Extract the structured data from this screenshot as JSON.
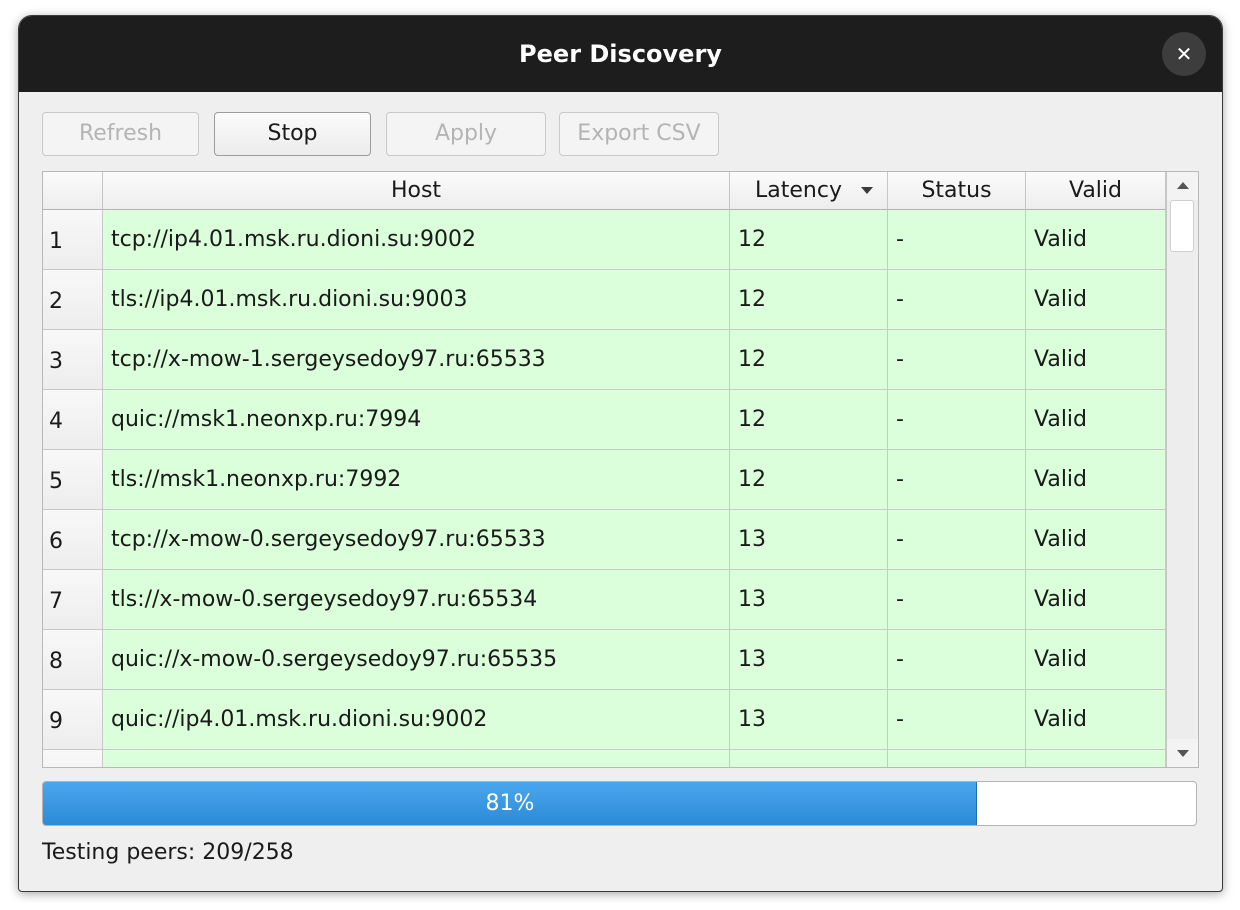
{
  "window": {
    "title": "Peer Discovery",
    "close_glyph": "✕"
  },
  "toolbar": {
    "refresh_label": "Refresh",
    "stop_label": "Stop",
    "apply_label": "Apply",
    "export_label": "Export CSV"
  },
  "table": {
    "columns": [
      "Host",
      "Latency",
      "Status",
      "Valid"
    ],
    "sort_column": "Latency",
    "rows": [
      {
        "num": "1",
        "host": "tcp://ip4.01.msk.ru.dioni.su:9002",
        "latency": "12",
        "status": "-",
        "valid": "Valid"
      },
      {
        "num": "2",
        "host": "tls://ip4.01.msk.ru.dioni.su:9003",
        "latency": "12",
        "status": "-",
        "valid": "Valid"
      },
      {
        "num": "3",
        "host": "tcp://x-mow-1.sergeysedoy97.ru:65533",
        "latency": "12",
        "status": "-",
        "valid": "Valid"
      },
      {
        "num": "4",
        "host": "quic://msk1.neonxp.ru:7994",
        "latency": "12",
        "status": "-",
        "valid": "Valid"
      },
      {
        "num": "5",
        "host": "tls://msk1.neonxp.ru:7992",
        "latency": "12",
        "status": "-",
        "valid": "Valid"
      },
      {
        "num": "6",
        "host": "tcp://x-mow-0.sergeysedoy97.ru:65533",
        "latency": "13",
        "status": "-",
        "valid": "Valid"
      },
      {
        "num": "7",
        "host": "tls://x-mow-0.sergeysedoy97.ru:65534",
        "latency": "13",
        "status": "-",
        "valid": "Valid"
      },
      {
        "num": "8",
        "host": "quic://x-mow-0.sergeysedoy97.ru:65535",
        "latency": "13",
        "status": "-",
        "valid": "Valid"
      },
      {
        "num": "9",
        "host": "quic://ip4.01.msk.ru.dioni.su:9002",
        "latency": "13",
        "status": "-",
        "valid": "Valid"
      },
      {
        "num": "",
        "host": "",
        "latency": "",
        "status": "",
        "valid": ""
      }
    ]
  },
  "progress": {
    "value": 81,
    "label": "81%"
  },
  "status": {
    "text": "Testing peers: 209/258"
  },
  "colors": {
    "valid_row_bg": "#dbfedb",
    "progress_fill": "#2f8fdc",
    "titlebar_bg": "#1d1d1d"
  }
}
